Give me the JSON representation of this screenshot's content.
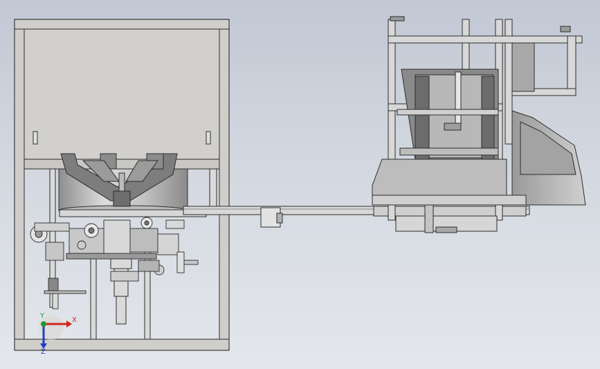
{
  "viewport": {
    "background_top": "#c2c8d4",
    "background_bottom": "#e4e7ec"
  },
  "model_colors": {
    "panel_fill": "#d2d0cc",
    "frame_fill": "#cfcecb",
    "profile_fill": "#d8d8d8",
    "edge": "#2b2b2b",
    "dark": "#5a5a5a"
  },
  "triad": {
    "x_label": "X",
    "y_label": "Y",
    "z_label": "Z",
    "x_color": "#d0241c",
    "y_color": "#1e9a32",
    "z_color": "#1d3fbf"
  }
}
